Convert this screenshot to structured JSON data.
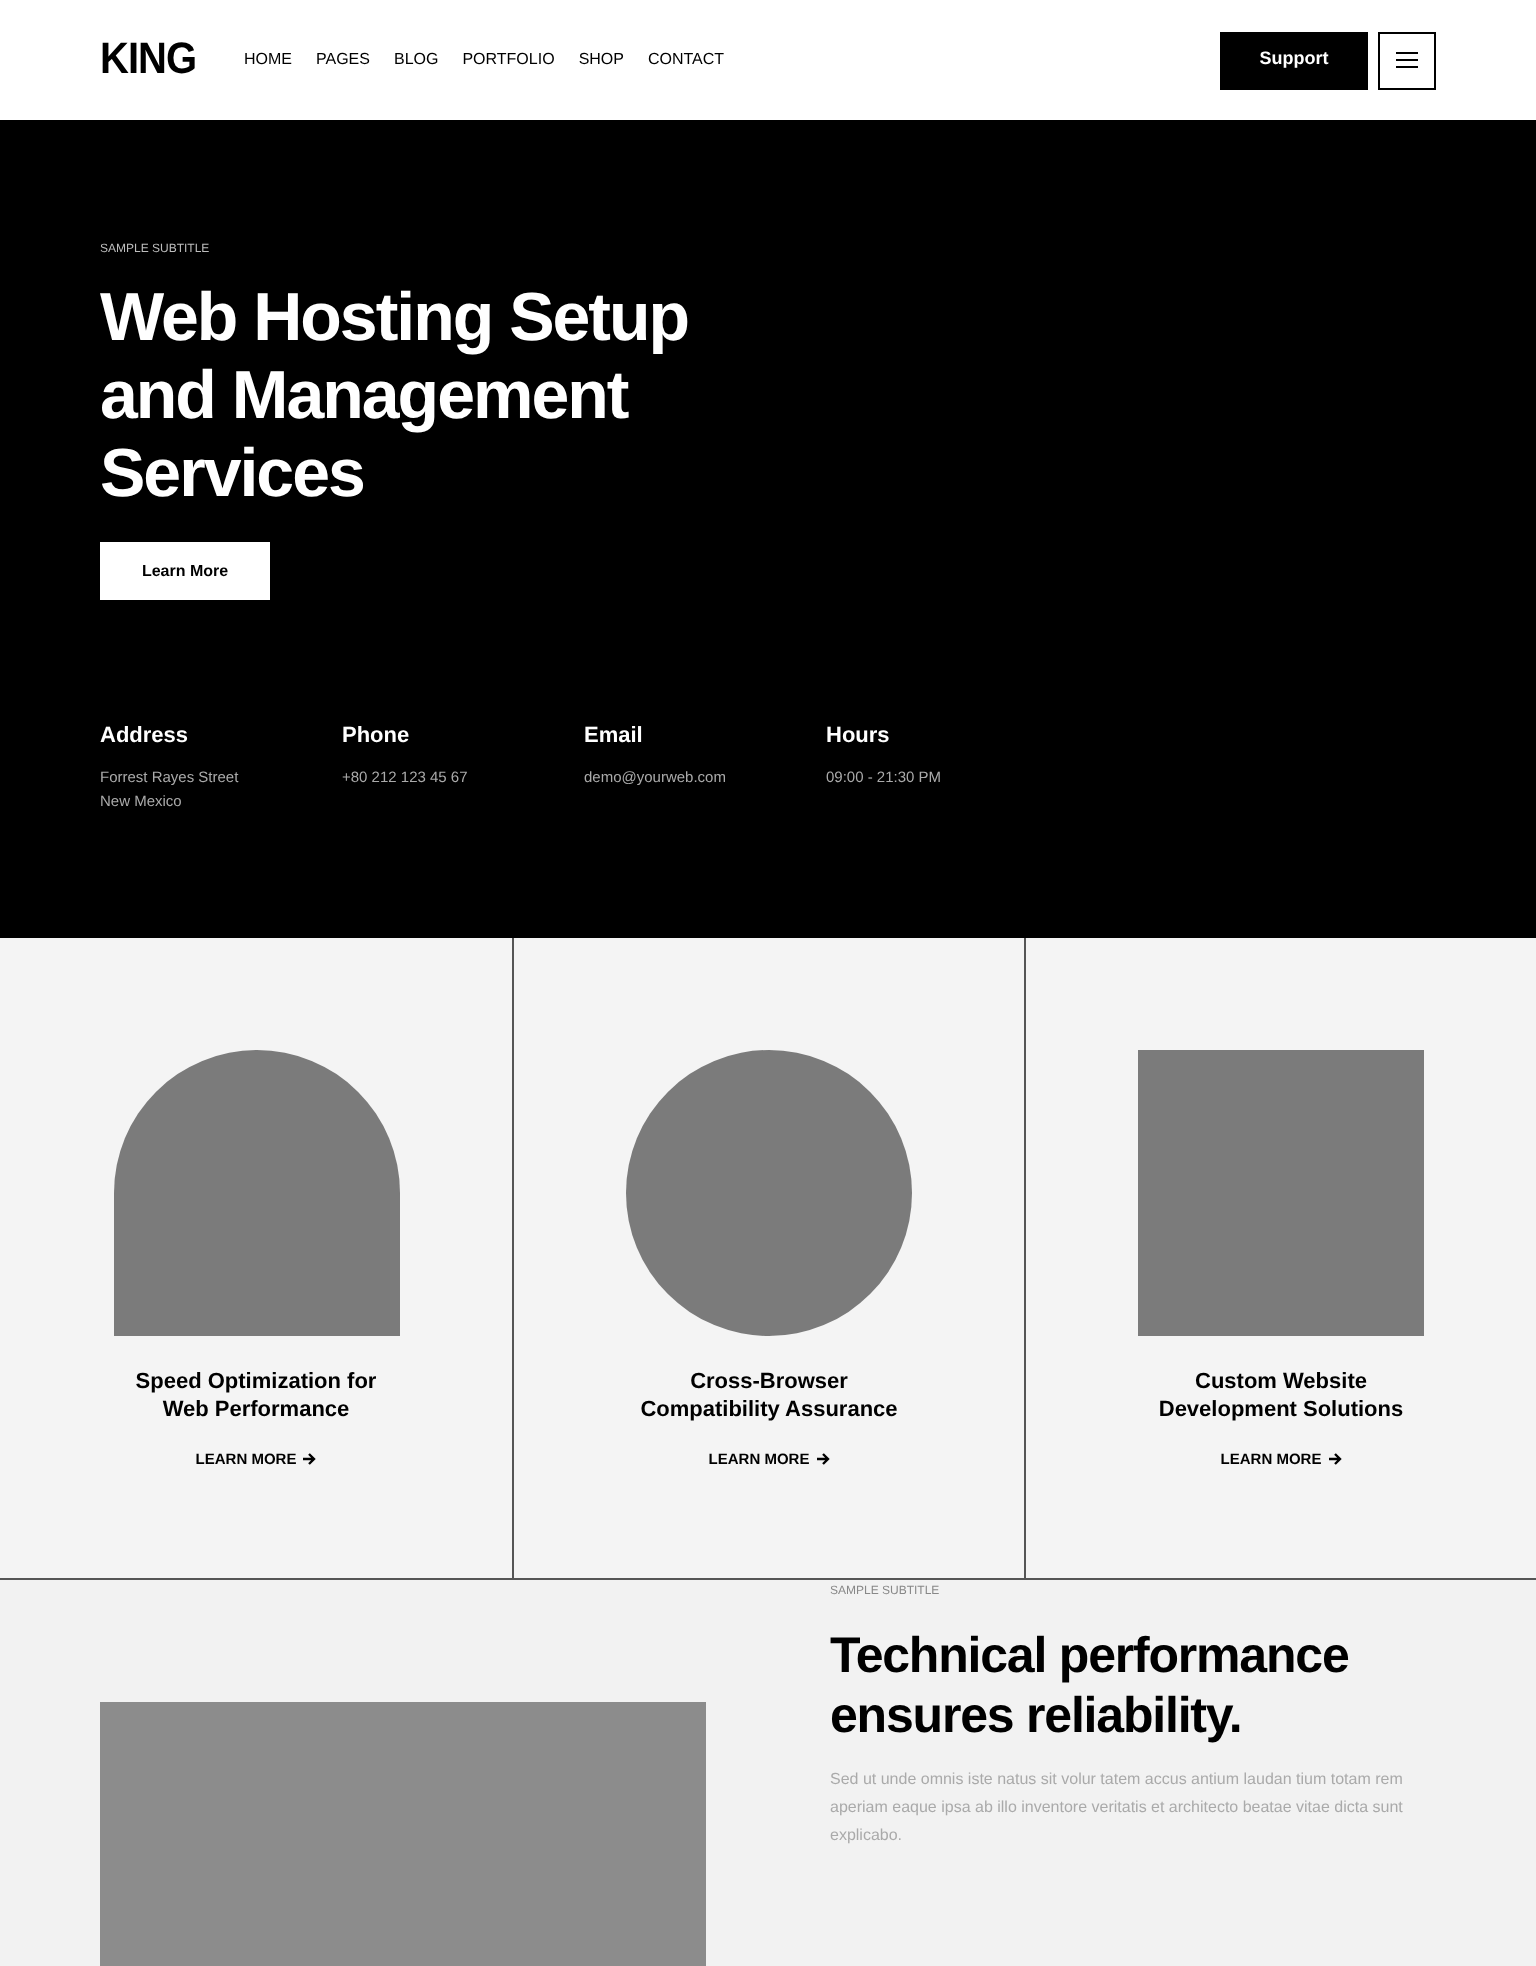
{
  "header": {
    "logo": "KING",
    "nav": [
      "HOME",
      "PAGES",
      "BLOG",
      "PORTFOLIO",
      "SHOP",
      "CONTACT"
    ],
    "support_button": "Support"
  },
  "hero": {
    "subtitle": "SAMPLE SUBTITLE",
    "title": [
      "Web Hosting Setup",
      "and Management",
      "Services"
    ],
    "button": "Learn More",
    "contacts": [
      {
        "label": "Address",
        "lines": [
          "Forrest Rayes Street",
          "New Mexico"
        ]
      },
      {
        "label": "Phone",
        "lines": [
          "+80 212 123 45 67"
        ]
      },
      {
        "label": "Email",
        "lines": [
          "demo@yourweb.com"
        ]
      },
      {
        "label": "Hours",
        "lines": [
          "09:00 - 21:30 PM"
        ]
      }
    ]
  },
  "services": [
    {
      "kind": "arch",
      "title": [
        "Speed Optimization for",
        "Web Performance"
      ],
      "link": "LEARN MORE"
    },
    {
      "kind": "circle",
      "title": [
        "Cross-Browser",
        "Compatibility Assurance"
      ],
      "link": "LEARN MORE"
    },
    {
      "kind": "square",
      "title": [
        "Custom Website",
        "Development Solutions"
      ],
      "link": "LEARN MORE"
    }
  ],
  "about": {
    "subtitle": "SAMPLE SUBTITLE",
    "title": [
      "Technical performance",
      "ensures reliability."
    ],
    "text": "Sed ut unde omnis iste natus sit volur tatem accus antium laudan tium totam rem aperiam eaque ipsa ab illo inventore veritatis et architecto beatae vitae dicta sunt explicabo."
  }
}
